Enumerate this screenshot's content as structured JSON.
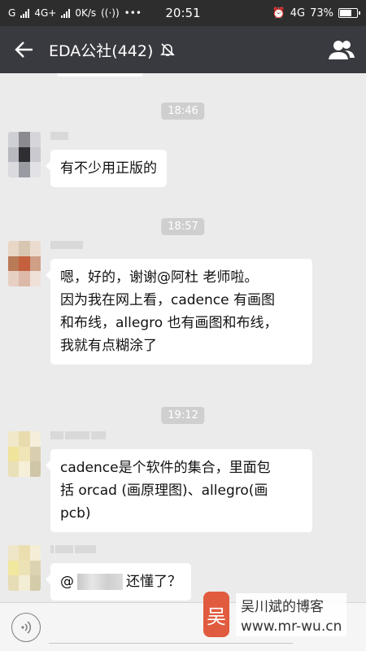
{
  "status_bar": {
    "carrier1": "G",
    "network": "4G+",
    "speed": "0K/s",
    "time": "20:51",
    "network_right": "4G",
    "battery": "73%",
    "battery_level": 0.73
  },
  "title_bar": {
    "title": "EDA公社(442)",
    "icons": {
      "back": "arrow-left-icon",
      "mute": "bell-off-icon",
      "group": "group-members-icon"
    }
  },
  "chat": {
    "messages": [
      {
        "type": "time",
        "text": "18:46"
      },
      {
        "type": "message",
        "text": "有不少用正版的"
      },
      {
        "type": "time",
        "text": "18:57"
      },
      {
        "type": "message",
        "lines": [
          "嗯，好的，谢谢@阿杜   老师啦。",
          "因为我在网上看，cadence 有画图",
          "和布线，allegro 也有画图和布线，",
          "我就有点糊涂了"
        ]
      },
      {
        "type": "time",
        "text": "19:12"
      },
      {
        "type": "message",
        "lines": [
          "cadence是个软件的集合，里面包",
          "括 orcad (画原理图)、allegro(画",
          "pcb)"
        ]
      },
      {
        "type": "message",
        "prefix": "@",
        "suffix": "还懂了？"
      }
    ]
  },
  "input_bar": {
    "voice_icon": "voice-icon"
  },
  "watermark": {
    "logo": "吴",
    "name": "吴川斌的博客",
    "url": "www.mr-wu.cn"
  }
}
